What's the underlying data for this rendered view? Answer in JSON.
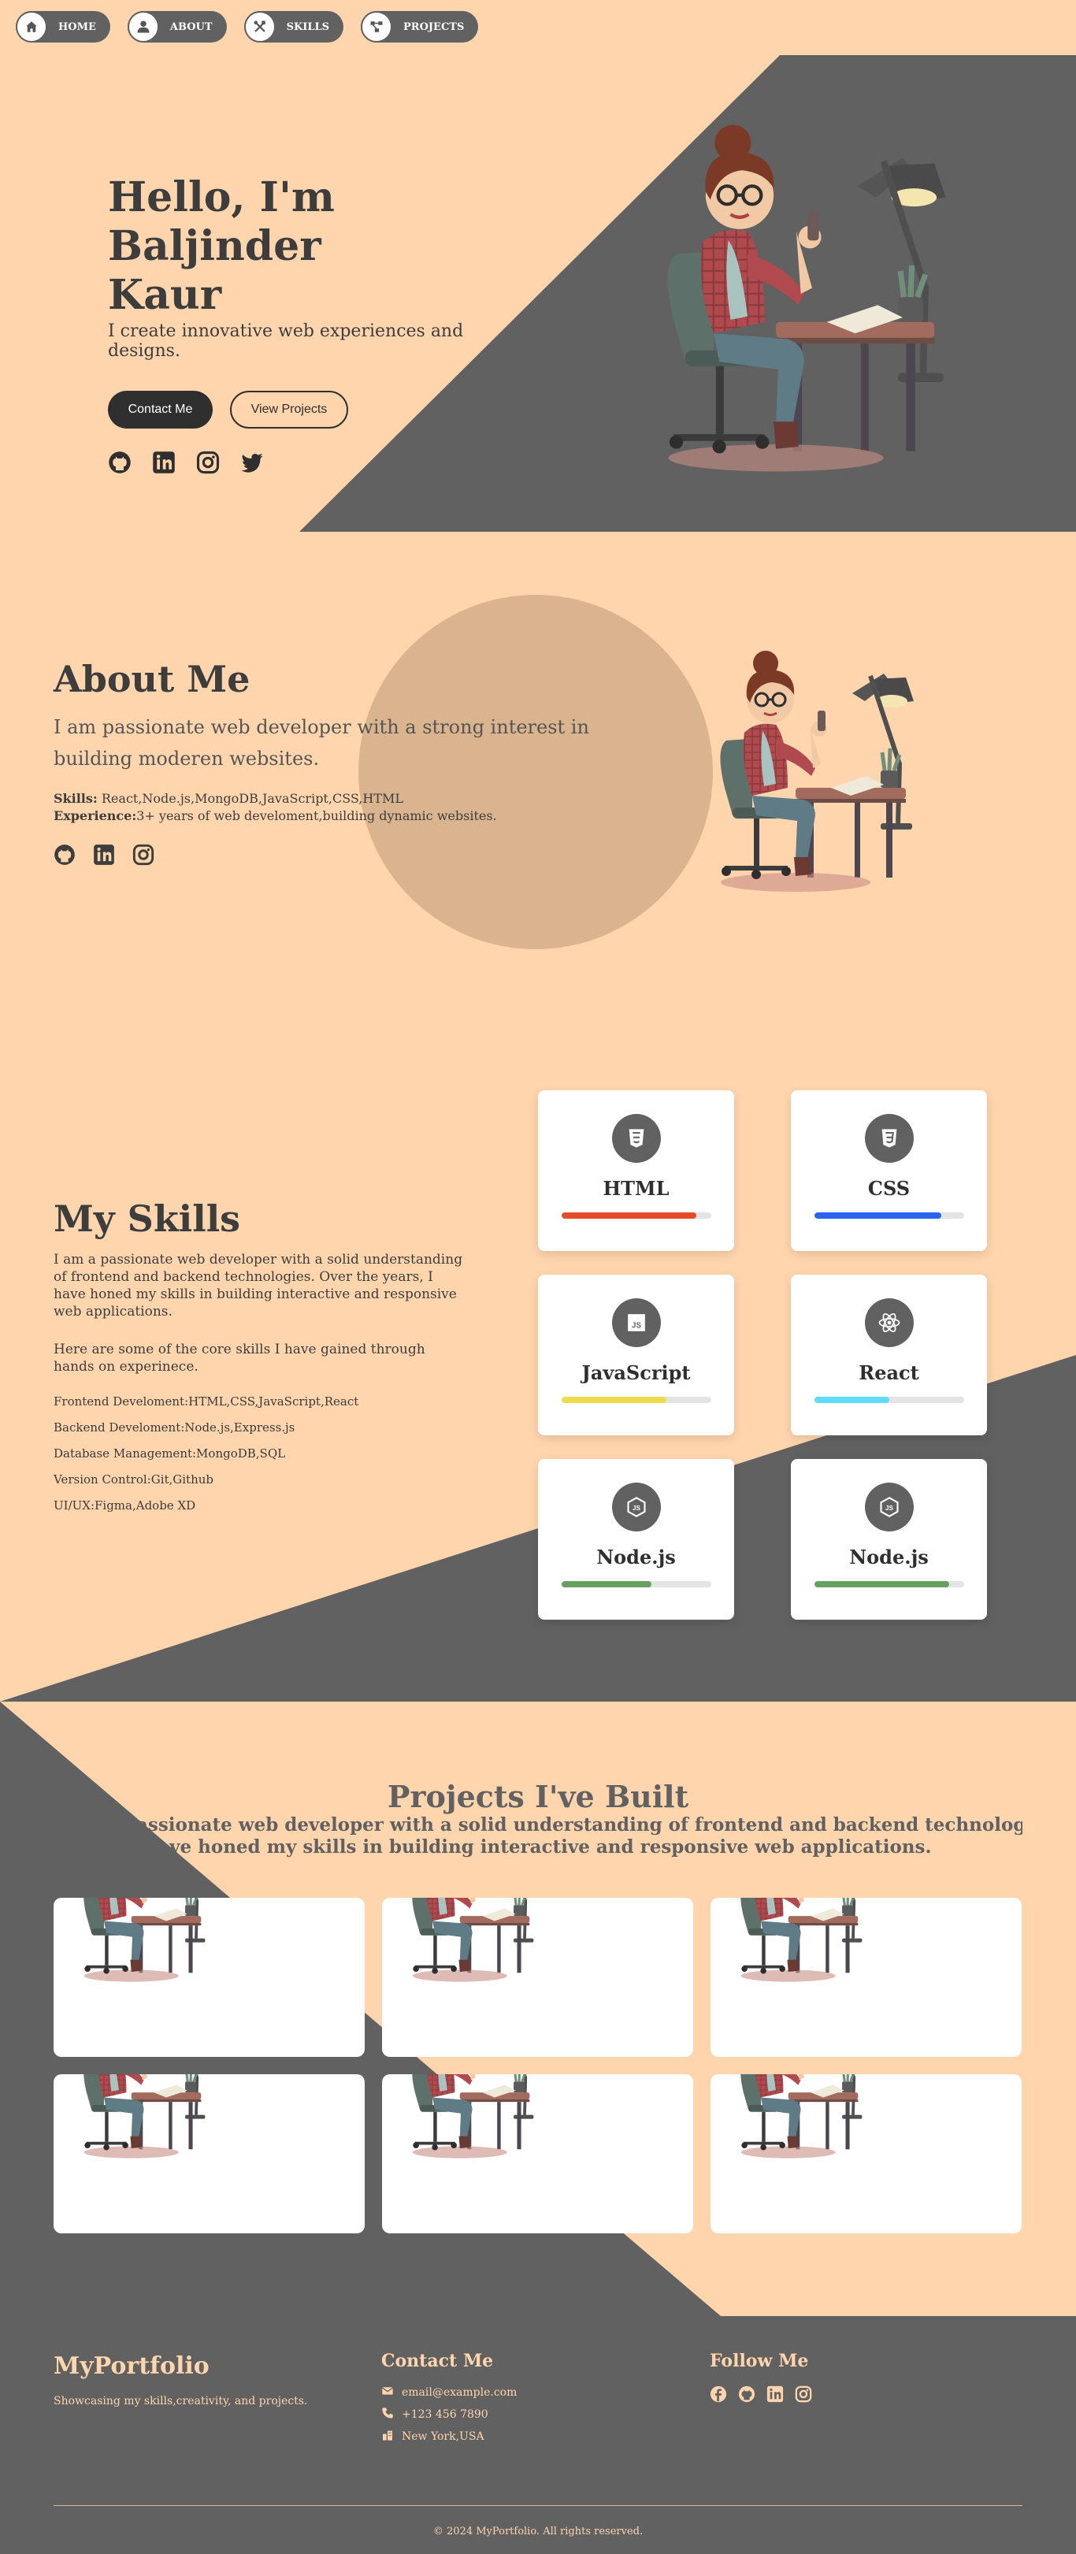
{
  "nav": {
    "items": [
      {
        "label": "HOME",
        "icon": "home-icon"
      },
      {
        "label": "ABOUT",
        "icon": "user-icon"
      },
      {
        "label": "SKILLS",
        "icon": "tools-icon"
      },
      {
        "label": "PROJECTS",
        "icon": "project-diagram-icon"
      }
    ]
  },
  "hero": {
    "title_line1": "Hello, I'm Baljinder",
    "title_line2": "Kaur",
    "subtitle": "I create innovative web experiences and designs.",
    "btn_contact": "Contact Me",
    "btn_projects": "View Projects",
    "socials": [
      "github-icon",
      "linkedin-icon",
      "instagram-icon",
      "twitter-icon"
    ]
  },
  "about": {
    "title": "About Me",
    "lead": "I am passionate web developer with a strong interest in building moderen websites.",
    "skills_label": "Skills:",
    "skills_value": " React,Node.js,MongoDB,JavaScript,CSS,HTML",
    "exp_label": "Experience:",
    "exp_value": "3+ years of web develoment,building dynamic websites.",
    "socials": [
      "github-icon",
      "linkedin-icon",
      "instagram-icon"
    ]
  },
  "skills": {
    "title": "My Skills",
    "para1": "I am a passionate web developer with a solid understanding of frontend and backend technologies. Over the years, I have honed my skills in building interactive and responsive web applications.",
    "para2": "Here are some of the core skills I have gained through hands on experinece.",
    "list": [
      "Frontend Develoment:HTML,CSS,JavaScript,React",
      "Backend Develoment:Node.js,Express.js",
      "Database Management:MongoDB,SQL",
      "Version Control:Git,Github",
      "UI/UX:Figma,Adobe XD"
    ],
    "cards": [
      {
        "name": "HTML",
        "icon": "html5-icon",
        "level": 0.9,
        "color": "#e34c26"
      },
      {
        "name": "CSS",
        "icon": "css3-icon",
        "level": 0.85,
        "color": "#2965f1"
      },
      {
        "name": "JavaScript",
        "icon": "js-icon",
        "level": 0.7,
        "color": "#f0db4f"
      },
      {
        "name": "React",
        "icon": "react-icon",
        "level": 0.5,
        "color": "#61dafb"
      },
      {
        "name": "Node.js",
        "icon": "nodejs-icon",
        "level": 0.6,
        "color": "#68a063"
      },
      {
        "name": "Node.js",
        "icon": "nodejs-icon",
        "level": 0.9,
        "color": "#68a063"
      }
    ]
  },
  "projects": {
    "title": "Projects I've Built",
    "sub_line1": "I am a passionate web developer with a solid understanding of frontend and backend technologies. Over the years, I",
    "sub_line2": "have honed my skills in building interactive and responsive web applications.",
    "count": 6
  },
  "footer": {
    "brand": "MyPortfolio",
    "tagline": "Showcasing my skills,creativity, and projects.",
    "contact_title": "Contact Me",
    "email": "email@example.com",
    "phone": "+123 456 7890",
    "location": "New York,USA",
    "follow_title": "Follow Me",
    "follow_icons": [
      "facebook-icon",
      "github-icon",
      "linkedin-icon",
      "instagram-icon"
    ],
    "copyright": "© 2024 MyPortfolio. All rights reserved."
  },
  "colors": {
    "background": "#ffd5ad",
    "dark": "#616161",
    "text": "#3d3d3d"
  }
}
